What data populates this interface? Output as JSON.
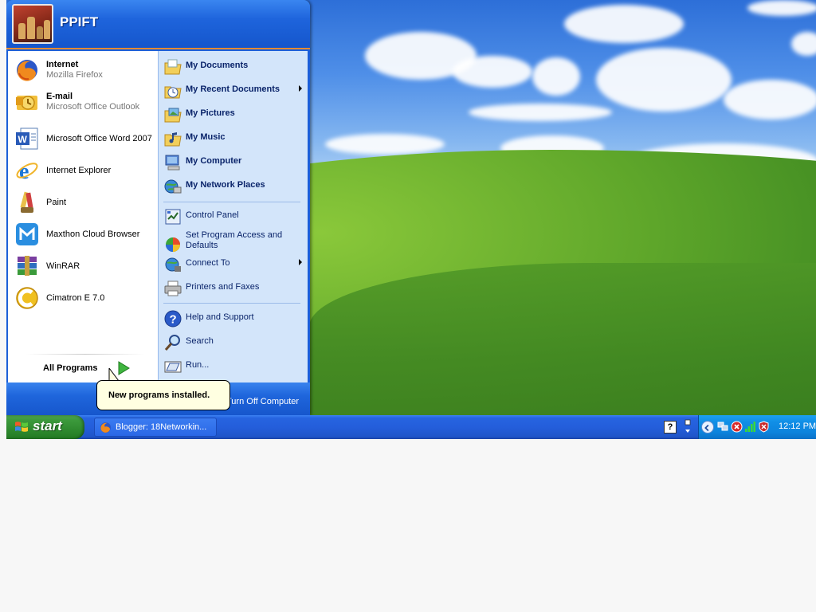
{
  "user": {
    "name": "PPIFT",
    "picture_icon": "chess-pieces-icon"
  },
  "start_menu": {
    "pinned": [
      {
        "title": "Internet",
        "subtitle": "Mozilla Firefox",
        "icon": "firefox-icon"
      },
      {
        "title": "E-mail",
        "subtitle": "Microsoft Office Outlook",
        "icon": "outlook-icon"
      }
    ],
    "recent": [
      {
        "title": "Microsoft Office Word 2007",
        "icon": "word-icon"
      },
      {
        "title": "Internet Explorer",
        "icon": "internet-explorer-icon"
      },
      {
        "title": "Paint",
        "icon": "paint-icon"
      },
      {
        "title": "Maxthon Cloud Browser",
        "icon": "maxthon-icon"
      },
      {
        "title": "WinRAR",
        "icon": "winrar-icon"
      },
      {
        "title": "Cimatron E 7.0",
        "icon": "cimatron-icon"
      }
    ],
    "all_programs_label": "All Programs",
    "places": [
      {
        "label": "My Documents",
        "icon": "my-documents-icon"
      },
      {
        "label": "My Recent Documents",
        "icon": "recent-documents-icon",
        "has_submenu": true
      },
      {
        "label": "My Pictures",
        "icon": "my-pictures-icon"
      },
      {
        "label": "My Music",
        "icon": "my-music-icon"
      },
      {
        "label": "My Computer",
        "icon": "my-computer-icon"
      },
      {
        "label": "My Network Places",
        "icon": "network-places-icon"
      }
    ],
    "system": [
      {
        "label": "Control Panel",
        "icon": "control-panel-icon"
      },
      {
        "label": "Set Program Access and Defaults",
        "icon": "program-access-icon"
      },
      {
        "label": "Connect To",
        "icon": "connect-to-icon",
        "has_submenu": true
      },
      {
        "label": "Printers and Faxes",
        "icon": "printer-icon"
      }
    ],
    "utilities": [
      {
        "label": "Help and Support",
        "icon": "help-icon"
      },
      {
        "label": "Search",
        "icon": "search-icon"
      },
      {
        "label": "Run...",
        "icon": "run-icon"
      }
    ],
    "turn_off_label": "Turn Off Computer"
  },
  "balloon": {
    "text": "New programs installed."
  },
  "taskbar": {
    "start_label": "start",
    "tasks": [
      {
        "label": "Blogger: 18Networkin...",
        "icon": "firefox-icon"
      }
    ],
    "clock": "12:12 PM"
  },
  "colors": {
    "taskbar_blue": "#245edb",
    "start_green": "#3c9a3c",
    "tray_blue": "#0d84dd",
    "places_bg": "#d3e5fa",
    "header_orange": "#e48a32"
  }
}
